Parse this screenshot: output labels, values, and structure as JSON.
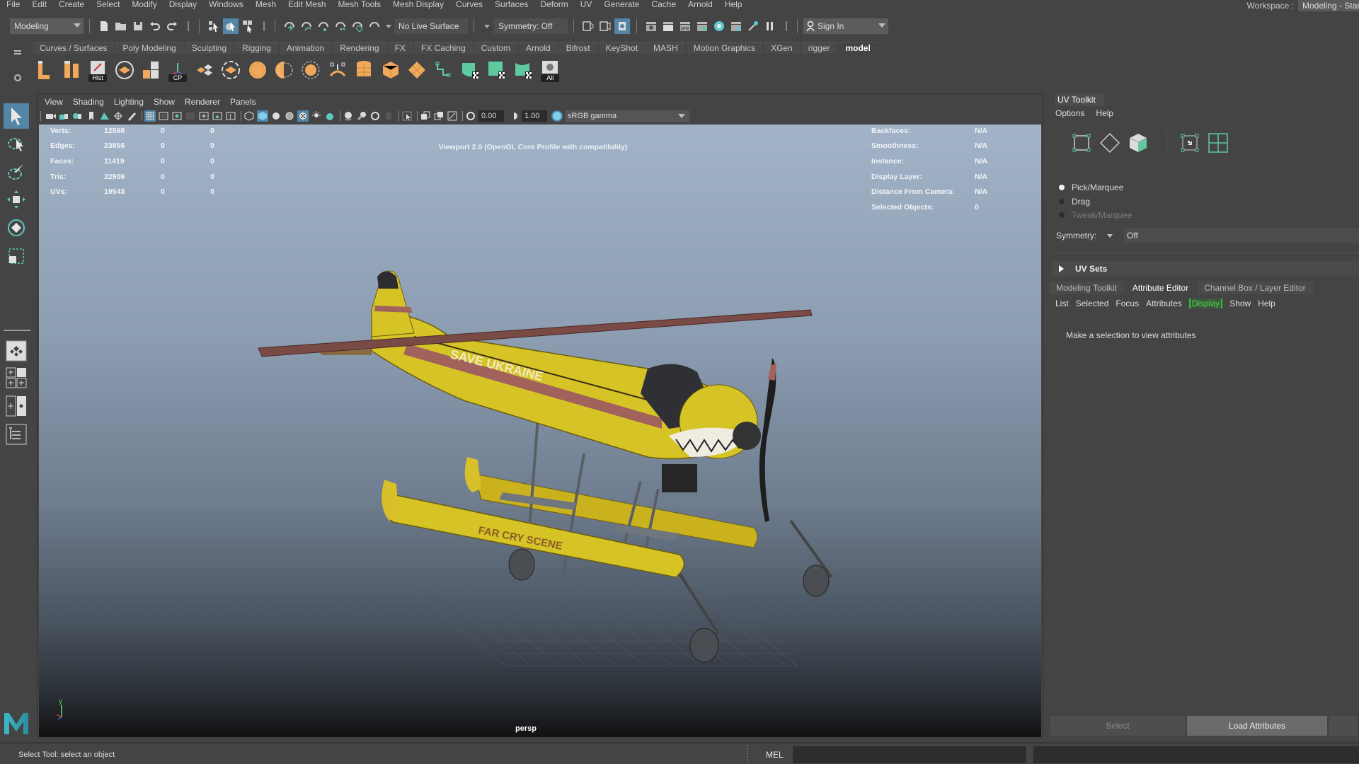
{
  "menubar": {
    "items": [
      "File",
      "Edit",
      "Create",
      "Select",
      "Modify",
      "Display",
      "Windows",
      "Mesh",
      "Edit Mesh",
      "Mesh Tools",
      "Mesh Display",
      "Curves",
      "Surfaces",
      "Deform",
      "UV",
      "Generate",
      "Cache",
      "Arnold",
      "Help"
    ],
    "workspace_label": "Workspace :",
    "workspace_value": "Modeling - Standard"
  },
  "statusline": {
    "menuset": "Modeling",
    "live_surface": "No Live Surface",
    "symmetry": "Symmetry: Off",
    "sign_in": "Sign In"
  },
  "shelf": {
    "tabs": [
      "Curves / Surfaces",
      "Poly Modeling",
      "Sculpting",
      "Rigging",
      "Animation",
      "Rendering",
      "FX",
      "FX Caching",
      "Custom",
      "Arnold",
      "Bifrost",
      "KeyShot",
      "MASH",
      "Motion Graphics",
      "XGen",
      "rigger",
      "model"
    ],
    "active_tab": "model",
    "icons": [
      {
        "name": "extrude-icon",
        "tag": ""
      },
      {
        "name": "bridge-icon",
        "tag": ""
      },
      {
        "name": "history-icon",
        "tag": "Hist"
      },
      {
        "name": "combine-icon",
        "tag": ""
      },
      {
        "name": "separate-icon",
        "tag": ""
      },
      {
        "name": "center-pivot-icon",
        "tag": "CP"
      },
      {
        "name": "merge-icon",
        "tag": ""
      },
      {
        "name": "bevel-icon",
        "tag": ""
      },
      {
        "name": "planar-map-icon",
        "tag": ""
      },
      {
        "name": "cylindrical-map-icon",
        "tag": ""
      },
      {
        "name": "spherical-map-icon",
        "tag": ""
      },
      {
        "name": "automatic-map-icon",
        "tag": ""
      },
      {
        "name": "cylinder-uv-icon",
        "tag": ""
      },
      {
        "name": "cube-uv-icon",
        "tag": ""
      },
      {
        "name": "unfold-icon",
        "tag": ""
      },
      {
        "name": "uv-shell-icon",
        "tag": ""
      },
      {
        "name": "uv-layout-a-icon",
        "tag": ""
      },
      {
        "name": "uv-layout-b-icon",
        "tag": ""
      },
      {
        "name": "uv-layout-c-icon",
        "tag": ""
      },
      {
        "name": "snapshot-all-icon",
        "tag": "All"
      }
    ]
  },
  "viewport": {
    "menu": [
      "View",
      "Shading",
      "Lighting",
      "Show",
      "Renderer",
      "Panels"
    ],
    "exposure": "0.00",
    "gamma": "1.00",
    "color_space": "sRGB gamma",
    "title": "Viewport 2.0 (OpenGL Core Profile with compatibility)",
    "camera": "persp",
    "stats": [
      {
        "label": "Verts:",
        "value": "12568",
        "sel": "0",
        "comp": "0"
      },
      {
        "label": "Edges:",
        "value": "23856",
        "sel": "0",
        "comp": "0"
      },
      {
        "label": "Faces:",
        "value": "11419",
        "sel": "0",
        "comp": "0"
      },
      {
        "label": "Tris:",
        "value": "22906",
        "sel": "0",
        "comp": "0"
      },
      {
        "label": "UVs:",
        "value": "19543",
        "sel": "0",
        "comp": "0"
      }
    ],
    "info": [
      {
        "label": "Backfaces:",
        "value": "N/A"
      },
      {
        "label": "Smoothness:",
        "value": "N/A"
      },
      {
        "label": "Instance:",
        "value": "N/A"
      },
      {
        "label": "Display Layer:",
        "value": "N/A"
      },
      {
        "label": "Distance From Camera:",
        "value": "N/A"
      },
      {
        "label": "Selected Objects:",
        "value": "0"
      }
    ],
    "model_texts": {
      "fuselage": "SAVE UKRAINE",
      "float": "FAR CRY SCENE"
    },
    "axis_label": "y"
  },
  "uv_toolkit": {
    "tab": "UV Toolkit",
    "menu": [
      "Options",
      "Help"
    ],
    "radios": [
      {
        "label": "Pick/Marquee",
        "checked": true,
        "disabled": false
      },
      {
        "label": "Drag",
        "checked": false,
        "disabled": false
      },
      {
        "label": "Tweak/Marquee",
        "checked": false,
        "disabled": true
      }
    ],
    "symmetry_label": "Symmetry:",
    "symmetry_value": "Off",
    "uv_sets": "UV Sets"
  },
  "attribute_editor": {
    "tabs": [
      "Modeling Toolkit",
      "Attribute Editor",
      "Channel Box / Layer Editor"
    ],
    "active_tab": "Attribute Editor",
    "menu": [
      "List",
      "Selected",
      "Focus",
      "Attributes",
      "Display",
      "Show",
      "Help"
    ],
    "highlighted_menu": "Display",
    "message": "Make a selection to view attributes",
    "select_button": "Select",
    "load_button": "Load Attributes"
  },
  "cmdline": {
    "help": "Select Tool: select an object",
    "language": "MEL"
  },
  "colors": {
    "accent": "#5285a6",
    "ui_bg": "#444444",
    "shelf_orange": "#f0a85a",
    "uv_green": "#5fc9a0",
    "display_green": "#45d845"
  }
}
